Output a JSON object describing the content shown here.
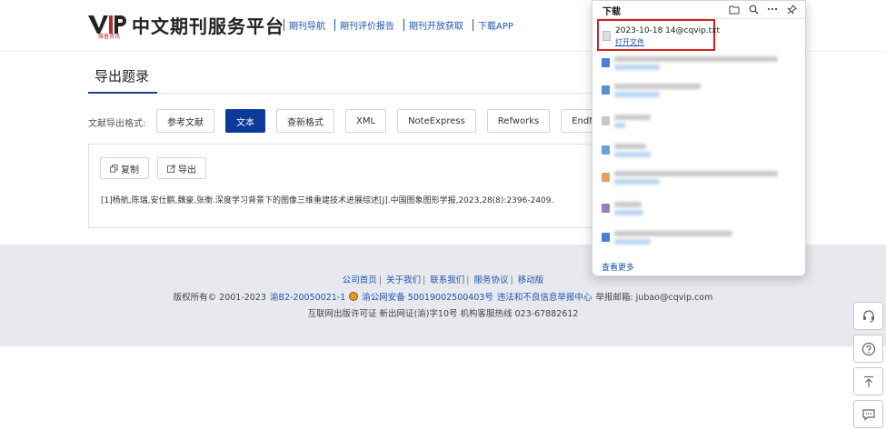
{
  "header": {
    "logo_sub": "维普资讯",
    "site_title": "中文期刊服务平台",
    "nav": [
      "期刊导航",
      "期刊评价报告",
      "期刊开放获取",
      "下载APP"
    ],
    "accent": "#1a56b0"
  },
  "main": {
    "page_title": "导出题录",
    "format_label": "文献导出格式:",
    "formats": [
      "参考文献",
      "文本",
      "查新格式",
      "XML",
      "NoteExpress",
      "Refworks",
      "EndNote"
    ],
    "active_format": "文本",
    "copy_label": "复制",
    "export_label": "导出",
    "citation": "[1]杨航,陈瑞,安仕鹏,魏豪,张衡.深度学习背景下的图像三维重建技术进展综述[J].中国图象图形学报,2023,28(8):2396-2409."
  },
  "footer": {
    "links": [
      "公司首页",
      "关于我们",
      "联系我们",
      "服务协议",
      "移动版"
    ],
    "copyright": "版权所有© 2001-2023",
    "icp": "渝B2-20050021-1",
    "police": "渝公网安备 50019002500403号",
    "report": "违法和不良信息举报中心",
    "email_label": "举报邮箱: jubao@cqvip.com",
    "row3": "互联网出版许可证 新出网证(渝)字10号   机构客服热线 023-67882612"
  },
  "downloads": {
    "title": "下载",
    "file_name": "2023-10-18 14@cqvip.txt",
    "open_file": "打开文件",
    "see_more": "查看更多",
    "highlight_color": "#d62020"
  },
  "colors": {
    "primary_button": "#0a3a9a",
    "footer_bg": "#e8e8ef"
  }
}
